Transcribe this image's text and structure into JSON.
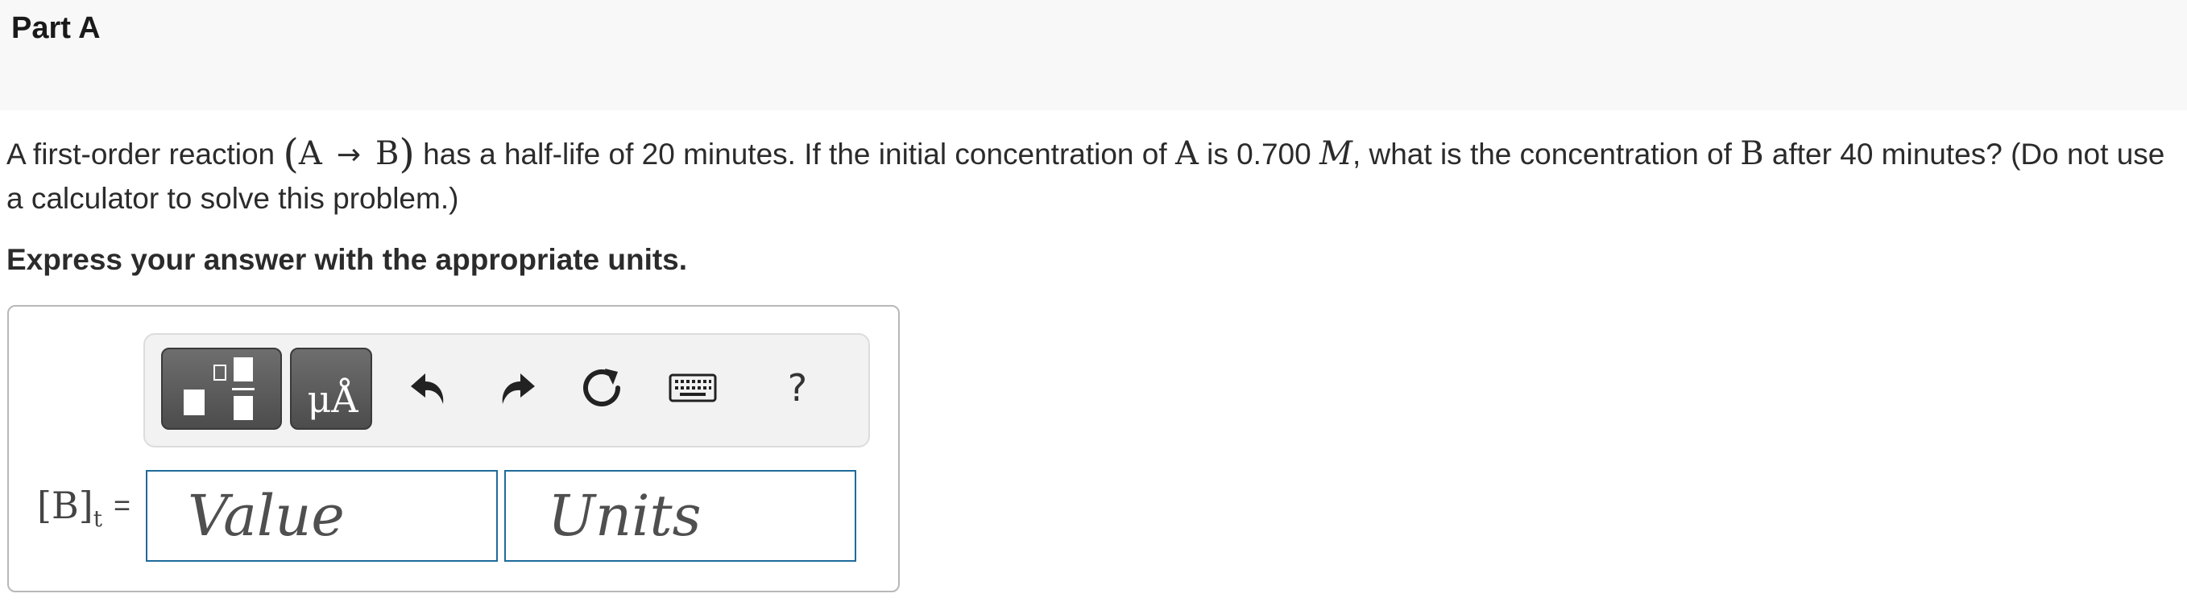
{
  "part": {
    "title": "Part A"
  },
  "question": {
    "text_1": "A first-order reaction ",
    "species_a": "A",
    "species_b": "B",
    "text_2": " has a half-life of 20 minutes. If the initial concentration of ",
    "text_3": " is 0.700 ",
    "unit_m": "M",
    "text_4": ", what is the concentration of ",
    "text_5": " after 40 minutes? (Do not use a calculator to solve this problem.)"
  },
  "instruction": "Express your answer with the appropriate units.",
  "toolbar": {
    "template_icon": "fraction-template-icon",
    "units_label": "μÅ",
    "undo_icon": "undo-icon",
    "redo_icon": "redo-icon",
    "reset_icon": "reset-icon",
    "keyboard_icon": "keyboard-icon",
    "help_label": "?"
  },
  "answer": {
    "label_main": "[B]",
    "label_sub": "t",
    "label_eq": "=",
    "value_placeholder": "Value",
    "units_placeholder": "Units",
    "value": "",
    "units": ""
  },
  "colors": {
    "header_bg": "#f8f8f8",
    "field_border": "#1f6b9a",
    "toolbar_button_dark": "#4c4c4c"
  }
}
